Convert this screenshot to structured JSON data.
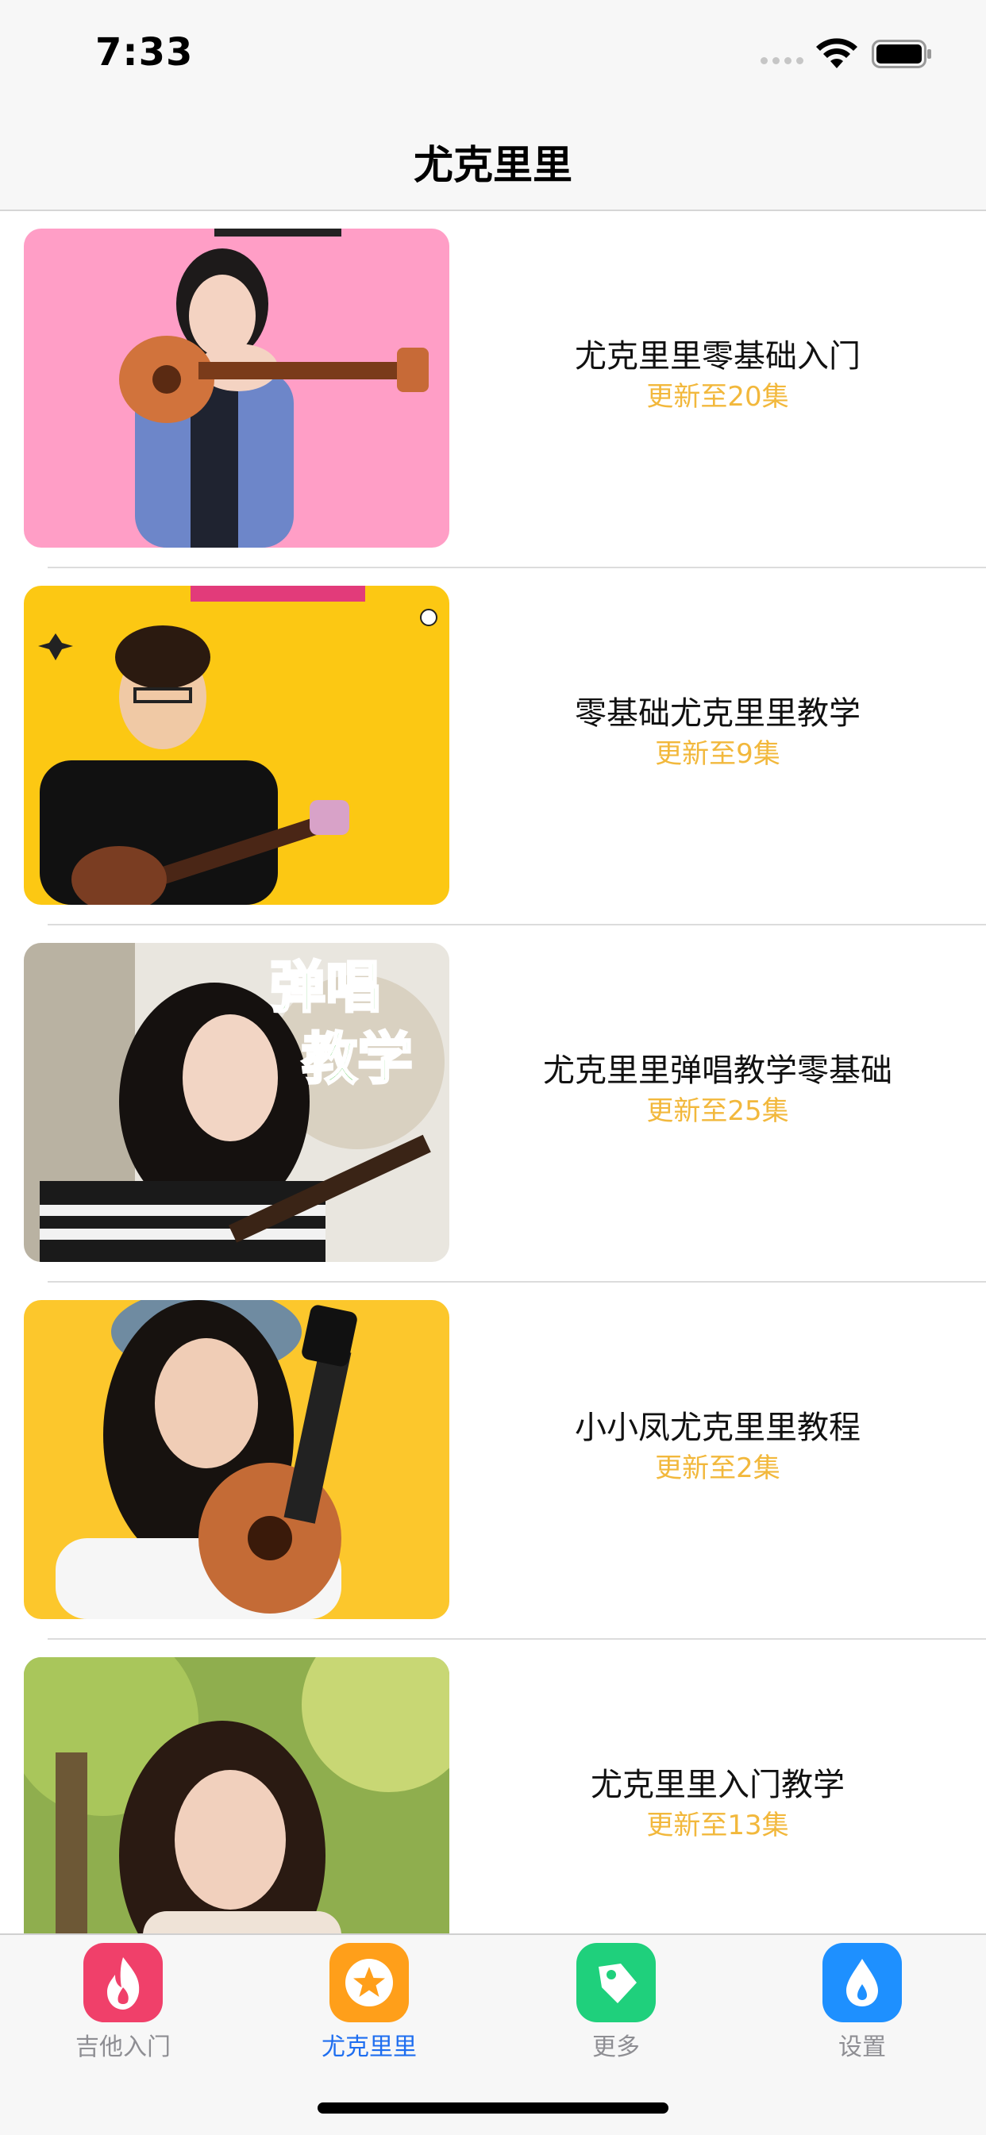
{
  "status": {
    "time": "7:33"
  },
  "nav": {
    "title": "尤克里里"
  },
  "list": [
    {
      "title": "尤克里里零基础入门",
      "subtitle": "更新至20集"
    },
    {
      "title": "零基础尤克里里教学",
      "subtitle": "更新至9集"
    },
    {
      "title": "尤克里里弹唱教学零基础",
      "subtitle": "更新至25集",
      "image_text": [
        "弹唱",
        "教学"
      ]
    },
    {
      "title": "小小凤尤克里里教程",
      "subtitle": "更新至2集"
    },
    {
      "title": "尤克里里入门教学",
      "subtitle": "更新至13集"
    }
  ],
  "tabs": [
    {
      "label": "吉他入门",
      "icon": "flame-icon",
      "color": "#f0406a",
      "active": false
    },
    {
      "label": "尤克里里",
      "icon": "star-icon",
      "color": "#ff9f1a",
      "active": true
    },
    {
      "label": "更多",
      "icon": "tag-icon",
      "color": "#1fd07c",
      "active": false
    },
    {
      "label": "设置",
      "icon": "drop-icon",
      "color": "#1e90ff",
      "active": false
    }
  ],
  "colors": {
    "accent": "#1e6ef0",
    "subtitle": "#f2b83c"
  }
}
